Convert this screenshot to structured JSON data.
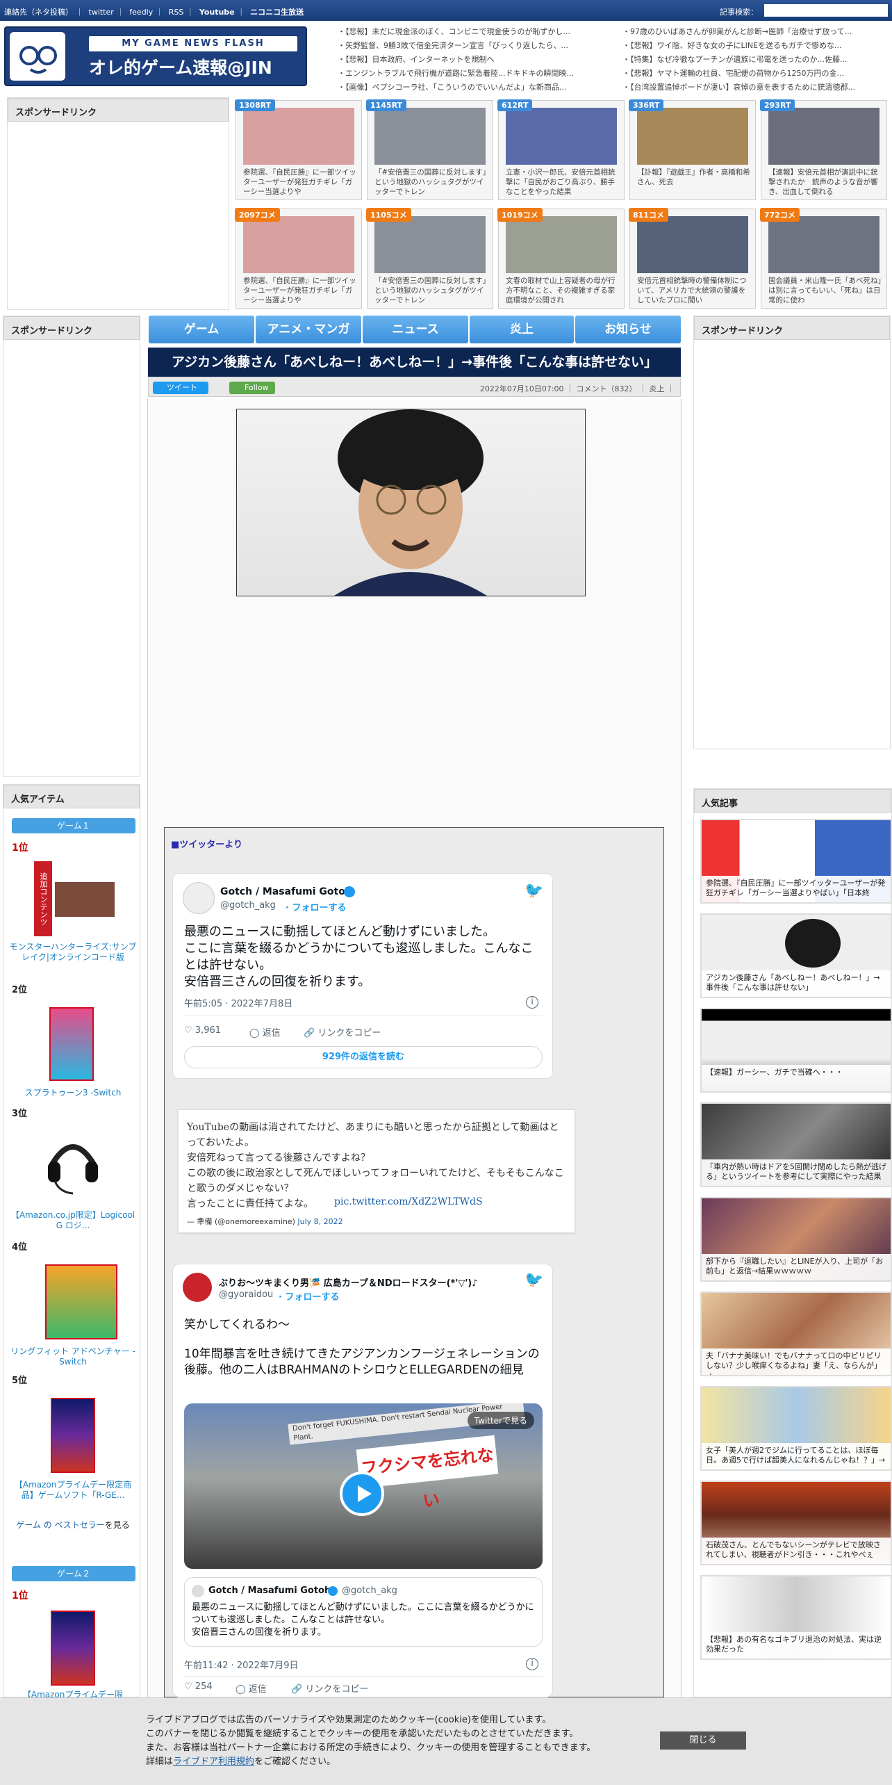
{
  "topbar": {
    "links": [
      "連絡先（ネタ投稿）",
      "twitter",
      "feedly",
      "RSS",
      "Youtube",
      "ニコニコ生放送"
    ],
    "search_label": "記事検索："
  },
  "logo": {
    "line1": "MY GAME NEWS FLASH",
    "line2": "オレ的ゲーム速報@JIN"
  },
  "header_news": {
    "left": [
      "【悲報】未だに現金派のぼく、コンビニで現金使うのが恥ずかし...",
      "矢野監督、9勝3敗で借金完済ターン宣言「びっくり返したら、...",
      "【悲報】日本政府、インターネットを規制へ",
      "エンジントラブルで飛行機が道路に緊急着陸...ドキドキの瞬間映...",
      "【画像】ペプシコーラ社、「こういうのでいいんだよ」な新商品..."
    ],
    "right": [
      "97歳のひいばあさんが卵巣がんと診断→医師「治療せず放って...",
      "【悲報】ワイ陰、好きな女の子にLINEを送るもガチで惨めな...",
      "【特集】なぜ冷徹なプーチンが遺族に弔電を送ったのか...佐藤...",
      "【悲報】ヤマト運輸の社員、宅配便の荷物から1250万円の金...",
      "【台湾設置追悼ボードが凄い】哀悼の意を表するために銃清徳郡..."
    ]
  },
  "sponsor": {
    "label": "スポンサードリンク"
  },
  "thumbs_row1": [
    {
      "badge": "1308RT",
      "cap": "参院選、『自民圧勝』に一部ツイッターユーザーが発狂ガチギレ「ガーシー当選よりや"
    },
    {
      "badge": "1145RT",
      "cap": "「#安倍晋三の国葬に反対します」という地獄のハッシュタグがツイッターでトレン"
    },
    {
      "badge": "612RT",
      "cap": "立憲・小沢一郎氏、安倍元首相銃撃に「自民がおごり高ぶり、勝手なことをやった結果"
    },
    {
      "badge": "336RT",
      "cap": "【訃報】『遊戯王』作者・高橋和希さん、死去"
    },
    {
      "badge": "293RT",
      "cap": "【速報】安倍元首相が演説中に銃撃されたか　銃声のような音が響き、出血して倒れる"
    }
  ],
  "thumbs_row2": [
    {
      "badge": "2097コメ",
      "cap": "参院選、『自民圧勝』に一部ツイッターユーザーが発狂ガチギレ「ガーシー当選よりや"
    },
    {
      "badge": "1105コメ",
      "cap": "「#安倍晋三の国葬に反対します」という地獄のハッシュタグがツイッターでトレン"
    },
    {
      "badge": "1019コメ",
      "cap": "文春の取材で山上容疑者の母が行方不明なこと、その複雑すぎる家庭環境が公開され"
    },
    {
      "badge": "811コメ",
      "cap": "安倍元首相銃撃時の警備体制について、アメリカで大統領の警護をしていたプロに聞い"
    },
    {
      "badge": "772コメ",
      "cap": "国会議員・米山隆一氏「あべ死ね」は別に言ってもいい、「死ね」は日常的に使わ"
    }
  ],
  "nav": [
    "ゲーム",
    "アニメ・マンガ",
    "ニュース",
    "炎上",
    "お知らせ"
  ],
  "article": {
    "title": "アジカン後藤さん「あべしねー！あべしねー！」→事件後「こんな事は許せない」",
    "tweet_btn": "ツイート",
    "follow_btn": "Follow",
    "meta": "2022年07月10日07:00 ｜ コメント（832） ｜ 炎上 ｜",
    "twitter_from": "■ツイッターより"
  },
  "tweet1": {
    "name": "Gotch / Masafumi Gotoh",
    "handle": "@gotch_akg",
    "follow": "フォローする",
    "text": "最悪のニュースに動揺してほとんど動けずにいました。\nここに言葉を綴るかどうかについても逡巡しました。こんなことは許せない。\n安倍晋三さんの回復を祈ります。",
    "time": "午前5:05 · 2022年7月8日",
    "likes": "3,961",
    "reply": "返信",
    "copy": "リンクをコピー",
    "read_more": "929件の返信を読む"
  },
  "tweet2": {
    "text": "YouTubeの動画は消されてたけど、あまりにも酷いと思ったから証拠として動画はとっておいたよ。\n安倍死ねって言ってる後藤さんですよね？\nこの歌の後に政治家として死んでほしいってフォローいれてたけど、そもそもこんなこと歌うのダメじゃない？\n言ったことに責任持てよな。",
    "link": "pic.twitter.com/XdZ2WLTWdS",
    "author": "— 準備 (@onemoreexamine)",
    "date": "July 8, 2022"
  },
  "tweet3": {
    "name": "ぶりお～ツキまくり男🎏 広島カープ＆NDロードスター(*'▽')♪",
    "handle": "@gyoraidou",
    "follow": "フォローする",
    "text1": "笑かしてくれるわ～",
    "text2": "10年間暴言を吐き続けてきたアジアンカンフージェネレーションの後藤。他の二人はBRAHMANのトシロウとELLEGARDENの細見",
    "video_label": "Twitterで見る",
    "video_sign": "フクシマを忘れない",
    "video_sign2": "Don't forget FUKUSHIMA. Don't restart Sendai Nuclear Power Plant.",
    "quote_name": "Gotch / Masafumi Gotoh",
    "quote_handle": "@gotch_akg",
    "quote_text": "最悪のニュースに動揺してほとんど動けずにいました。ここに言葉を綴るかどうかについても逡巡しました。こんなことは許せない。\n安倍晋三さんの回復を祈ります。",
    "time": "午前11:42 · 2022年7月9日",
    "likes": "254",
    "reply": "返信",
    "copy": "リンクをコピー"
  },
  "ranking": {
    "title": "人気アイテム",
    "cat1": "ゲーム１",
    "cat2": "ゲーム２",
    "items": [
      {
        "rank": "1位",
        "title": "モンスターハンターライズ:サンブレイク|オンラインコード版"
      },
      {
        "rank": "2位",
        "title": "スプラトゥーン3 -Switch"
      },
      {
        "rank": "3位",
        "title": "【Amazon.co.jp限定】Logicool G ロジ..."
      },
      {
        "rank": "4位",
        "title": "リングフィット アドベンチャー -Switch"
      },
      {
        "rank": "5位",
        "title": "【Amazonプライムデー限定商品】ゲームソフト「R-GE..."
      }
    ],
    "bestseller_a": "ゲーム の ベストセラー",
    "bestseller_b": "を見る",
    "rank2_1": "1位",
    "rank2_1_title": "【Amazonプライムデー限"
  },
  "popular": {
    "title": "人気記事",
    "items": [
      "参院選、『自民圧勝』に一部ツイッターユーザーが発狂ガチギレ「ガーシー当選よりやばい」「日本終",
      "アジカン後藤さん「あべしねー！あべしねー！」→事件後「こんな事は許せない」",
      "【速報】ガーシー、ガチで当確へ・・・",
      "「車内が熱い時はドアを5回開け閉めしたら熱が逃げる」というツイートを参考にして実際にやった結果",
      "部下から『退職したい』とLINEが入り、上司が「お前も」と返信→結果ｗｗｗｗｗ",
      "夫「バナナ美味い！でもバナナって口の中ピリピリしない？少し喉痒くなるよね」妻「え、ならんが」→",
      "女子「美人が週2でジムに行ってることは、ほぼ毎日。あ週5で行けば超美人になれるんじゃね！？」→",
      "石破茂さん、とんでもないシーンがテレビで放映されてしまい、視聴者がドン引き・・・これやべぇ",
      "【悲報】あの有名なゴキブリ退治の対処法、実は逆効果だった"
    ]
  },
  "cookie": {
    "line1": "ライブドアブログでは広告のパーソナライズや効果測定のためクッキー(cookie)を使用しています。",
    "line2": "このバナーを閉じるか閲覧を継続することでクッキーの使用を承認いただいたものとさせていただきます。",
    "line3": "また、お客様は当社パートナー企業における所定の手続きにより、クッキーの使用を管理することもできます。",
    "line4a": "詳細は",
    "line4b": "ライブドア利用規約",
    "line4c": "をご確認ください。",
    "close": "閉じる"
  }
}
